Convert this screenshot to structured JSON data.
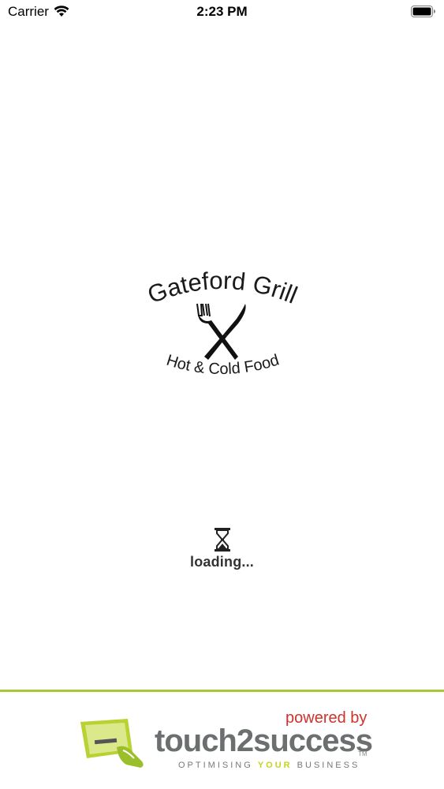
{
  "status_bar": {
    "carrier": "Carrier",
    "time": "2:23 PM"
  },
  "logo": {
    "title": "Gateford Grill",
    "subtitle": "Hot & Cold Food"
  },
  "loading": {
    "text": "loading..."
  },
  "footer": {
    "powered_by": "powered by",
    "brand": "touch2success",
    "tm": "TM",
    "tagline_pre": "OPTIMISING ",
    "tagline_highlight": "YOUR",
    "tagline_post": " BUSINESS",
    "accent_color": "#a9c734",
    "powered_color": "#d0312b"
  }
}
